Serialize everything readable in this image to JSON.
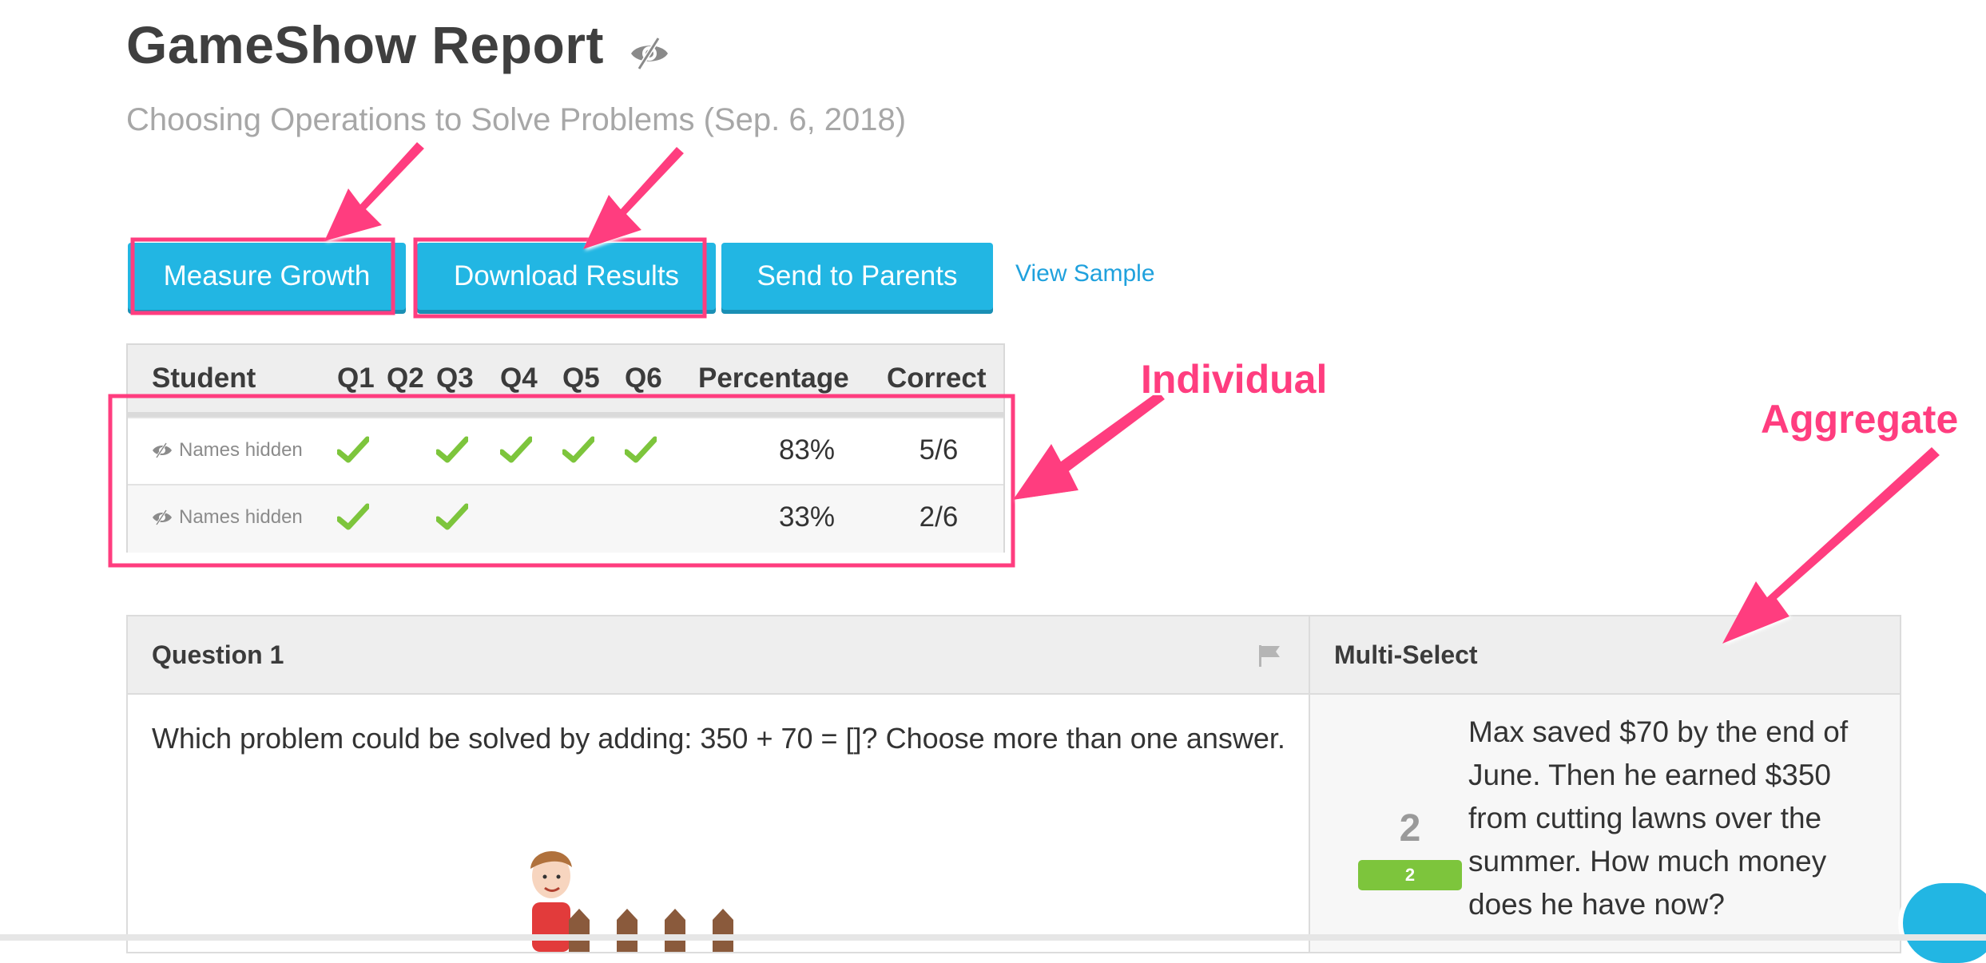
{
  "header": {
    "title": "GameShow Report",
    "subtitle": "Choosing Operations to Solve Problems (Sep. 6, 2018)",
    "visibility_icon": "eye-slash-icon"
  },
  "actions": {
    "measure_growth": "Measure Growth",
    "download_results": "Download Results",
    "send_to_parents": "Send to Parents",
    "view_sample": "View Sample"
  },
  "table": {
    "columns": [
      "Student",
      "Q1",
      "Q2",
      "Q3",
      "Q4",
      "Q5",
      "Q6",
      "Percentage",
      "Correct"
    ],
    "rows": [
      {
        "name": "Names hidden",
        "answers": [
          true,
          false,
          true,
          true,
          true,
          true
        ],
        "percentage": "83%",
        "correct": "5/6"
      },
      {
        "name": "Names hidden",
        "answers": [
          true,
          false,
          true,
          false,
          false,
          false
        ],
        "percentage": "33%",
        "correct": "2/6"
      }
    ],
    "check_color": "#7dc53c"
  },
  "question": {
    "title": "Question 1",
    "type": "Multi-Select",
    "text": "Which problem could be solved by adding: 350 + 70 = []? Choose more than one answer.",
    "flag_icon": "flag-icon",
    "aggregate": {
      "count": "2",
      "badge": "2",
      "answer_text": "Max saved $70 by the end of June. Then he earned $350 from cutting lawns over the summer. How much money does he have now?"
    }
  },
  "annotations": {
    "individual": "Individual",
    "aggregate": "Aggregate",
    "color": "#ff3d7f"
  },
  "chat": {
    "icon": "chat-bubble-icon",
    "dots": "..."
  },
  "colors": {
    "accent": "#22b6e3",
    "link": "#1fa1dd",
    "success": "#7dc53c"
  }
}
